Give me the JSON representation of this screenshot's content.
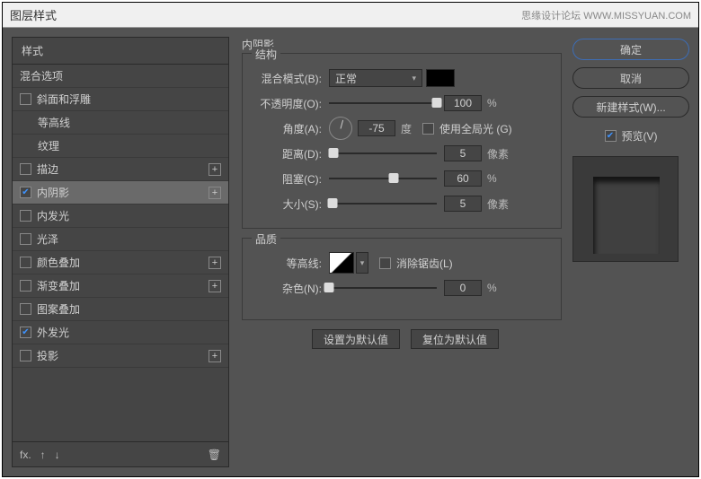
{
  "window": {
    "title": "图层样式"
  },
  "watermark": "思缘设计论坛  WWW.MISSYUAN.COM",
  "left": {
    "header": "样式",
    "blending_options": "混合选项",
    "items": [
      {
        "label": "斜面和浮雕",
        "checked": false,
        "indent": false,
        "plus": false
      },
      {
        "label": "等高线",
        "checked": false,
        "indent": true,
        "plus": false
      },
      {
        "label": "纹理",
        "checked": false,
        "indent": true,
        "plus": false
      },
      {
        "label": "描边",
        "checked": false,
        "indent": false,
        "plus": true
      },
      {
        "label": "内阴影",
        "checked": true,
        "indent": false,
        "plus": true,
        "selected": true
      },
      {
        "label": "内发光",
        "checked": false,
        "indent": false,
        "plus": false
      },
      {
        "label": "光泽",
        "checked": false,
        "indent": false,
        "plus": false
      },
      {
        "label": "颜色叠加",
        "checked": false,
        "indent": false,
        "plus": true
      },
      {
        "label": "渐变叠加",
        "checked": false,
        "indent": false,
        "plus": true
      },
      {
        "label": "图案叠加",
        "checked": false,
        "indent": false,
        "plus": false
      },
      {
        "label": "外发光",
        "checked": true,
        "indent": false,
        "plus": false
      },
      {
        "label": "投影",
        "checked": false,
        "indent": false,
        "plus": true
      }
    ]
  },
  "center": {
    "title": "内阴影",
    "structure": {
      "legend": "结构",
      "blend_mode_label": "混合模式(B):",
      "blend_mode_value": "正常",
      "opacity_label": "不透明度(O):",
      "opacity_value": "100",
      "opacity_unit": "%",
      "angle_label": "角度(A):",
      "angle_value": "-75",
      "angle_unit": "度",
      "global_light": "使用全局光 (G)",
      "distance_label": "距离(D):",
      "distance_value": "5",
      "distance_unit": "像素",
      "choke_label": "阻塞(C):",
      "choke_value": "60",
      "choke_unit": "%",
      "size_label": "大小(S):",
      "size_value": "5",
      "size_unit": "像素"
    },
    "quality": {
      "legend": "品质",
      "contour_label": "等高线:",
      "antialias": "消除锯齿(L)",
      "noise_label": "杂色(N):",
      "noise_value": "0",
      "noise_unit": "%"
    },
    "make_default": "设置为默认值",
    "reset_default": "复位为默认值"
  },
  "right": {
    "ok": "确定",
    "cancel": "取消",
    "new_style": "新建样式(W)...",
    "preview": "预览(V)"
  }
}
